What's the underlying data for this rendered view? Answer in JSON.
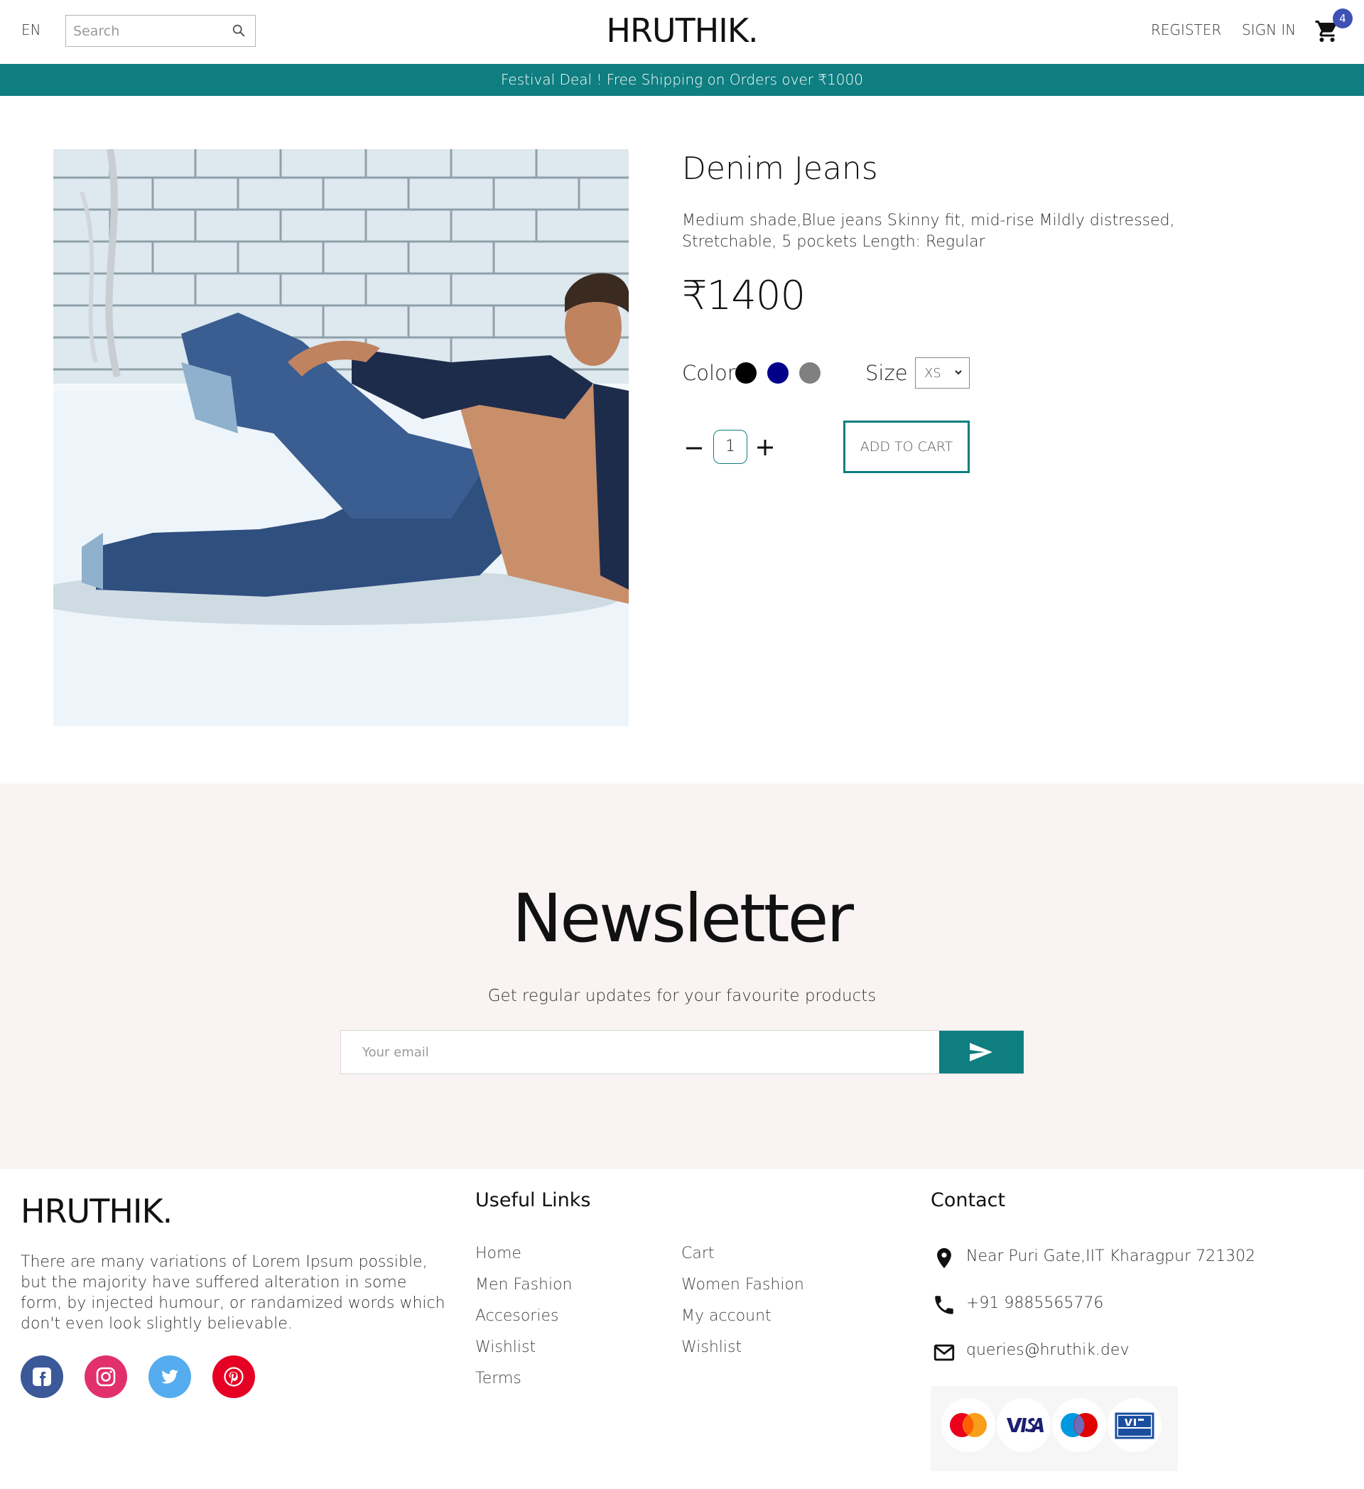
{
  "header": {
    "language": "EN",
    "search_placeholder": "Search",
    "logo": "HRUTHIK.",
    "register": "REGISTER",
    "sign_in": "SIGN IN",
    "cart_count": "4"
  },
  "announcement": "Festival Deal ! Free Shipping on Orders over ₹1000",
  "product": {
    "title": "Denim Jeans",
    "description": "Medium shade,Blue jeans Skinny fit, mid-rise Mildly distressed, Stretchable, 5 pockets Length: Regular",
    "price": "₹1400",
    "color_label": "Color",
    "colors": [
      "#000000",
      "#00008b",
      "#808080"
    ],
    "size_label": "Size",
    "size_selected": "XS",
    "quantity": "1",
    "add_to_cart": "ADD TO CART"
  },
  "newsletter": {
    "title": "Newsletter",
    "subtitle": "Get regular updates for your favourite products",
    "email_placeholder": "Your email"
  },
  "footer": {
    "logo": "HRUTHIK.",
    "about": "There are many variations of Lorem Ipsum possible, but the majority have suffered alteration in some form, by injected humour, or randamized words which don't even look slightly believable.",
    "social": [
      "facebook",
      "instagram",
      "twitter",
      "pinterest"
    ],
    "useful_links_title": "Useful Links",
    "links_col1": [
      "Home",
      "Men Fashion",
      "Accesories",
      "Wishlist",
      "Terms"
    ],
    "links_col2": [
      "Cart",
      "Women Fashion",
      "My account",
      "Wishlist"
    ],
    "contact_title": "Contact",
    "address": "Near Puri Gate,IIT Kharagpur 721302",
    "phone": "+91 9885565776",
    "email": "queries@hruthik.dev",
    "payment_methods": [
      "MasterCard",
      "VISA",
      "Maestro",
      "VISA Electron"
    ]
  },
  "colors": {
    "accent": "#0f7e80",
    "badge": "#3f51b5",
    "newsletter_bg": "#f9f4f3"
  }
}
